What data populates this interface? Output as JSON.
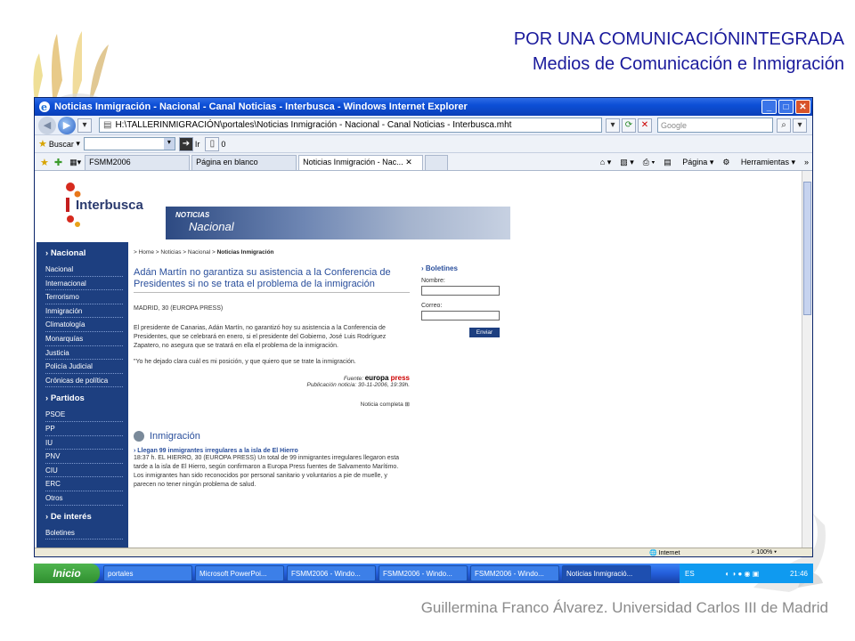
{
  "slide": {
    "title_line1": "POR UNA COMUNICACIÓNINTEGRADA",
    "title_line2": "Medios de Comunicación e Inmigración",
    "footer": "Guillermina Franco Álvarez. Universidad Carlos III de Madrid"
  },
  "browser": {
    "title": "Noticias Inmigración - Nacional - Canal Noticias - Interbusca - Windows Internet Explorer",
    "address": "H:\\TALLERINMIGRACIÓN\\portales\\Noticias Inmigración - Nacional - Canal Noticias - Interbusca.mht",
    "search_placeholder": "Google",
    "buscar_label": "Buscar",
    "ir_label": "Ir",
    "counter": "0",
    "tabs": [
      {
        "label": "FSMM2006"
      },
      {
        "label": "Página en blanco"
      },
      {
        "label": "Noticias Inmigración - Nac..."
      }
    ],
    "cmd_page": "Página",
    "cmd_tools": "Herramientas",
    "status_zone": "Internet",
    "zoom": "100%"
  },
  "site": {
    "logo": "Interbusca",
    "banner_small": "NOTICIAS",
    "banner_big": "Nacional",
    "nav": [
      {
        "section": "Nacional",
        "items": [
          "Nacional",
          "Internacional",
          "Terrorismo",
          "Inmigración",
          "Climatología",
          "Monarquías",
          "Justicia",
          "Policía Judicial",
          "Crónicas de política"
        ]
      },
      {
        "section": "Partidos",
        "items": [
          "PSOE",
          "PP",
          "IU",
          "PNV",
          "CIU",
          "ERC",
          "Otros"
        ]
      },
      {
        "section": "De interés",
        "items": [
          "Boletines"
        ]
      }
    ],
    "breadcrumb": "> Home > Noticias > Nacional >",
    "breadcrumb_current": "Noticias Inmigración",
    "headline": "Adán Martín no garantiza su asistencia a la Conferencia de Presidentes si no se trata el problema de la inmigración",
    "dateline": "MADRID, 30 (EUROPA PRESS)",
    "paragraph": "El presidente de Canarias, Adán Martín, no garantizó hoy su asistencia a la Conferencia de Presidentes, que se celebrará en enero, si el presidente del Gobierno, José Luis Rodríguez Zapatero, no asegura que se tratará en ella el problema de la inmigración.",
    "quote": "\"Yo he dejado clara cuál es mi posición, y que quiero que se trate la inmigración.",
    "source_label": "Fuente:",
    "source_brand_a": "europa",
    "source_brand_b": "press",
    "published": "Publicación noticia: 30-11-2006, 19:39h.",
    "full_link": "Noticia completa",
    "section_title": "Inmigración",
    "news2_title": "Llegan 99 inmigrantes irregulares a la isla de El Hierro",
    "news2_body": "18:37 h. EL HIERRO, 30 (EUROPA PRESS) Un total de 99 inmigrantes irregulares llegaron esta tarde a la isla de El Hierro, según confirmaron a Europa Press fuentes de Salvamento Marítimo. Los inmigrantes han sido reconocidos por personal sanitario y voluntarios a pie de muelle, y parecen no tener ningún problema de salud.",
    "boletines": {
      "title": "Boletines",
      "name_label": "Nombre:",
      "mail_label": "Correo:",
      "send": "Enviar"
    }
  },
  "taskbar": {
    "start": "Inicio",
    "items": [
      "portales",
      "Microsoft PowerPoi...",
      "FSMM2006 - Windo...",
      "FSMM2006 - Windo...",
      "FSMM2006 - Windo...",
      "Noticias Inmigració..."
    ],
    "lang": "ES",
    "clock": "21:46"
  }
}
